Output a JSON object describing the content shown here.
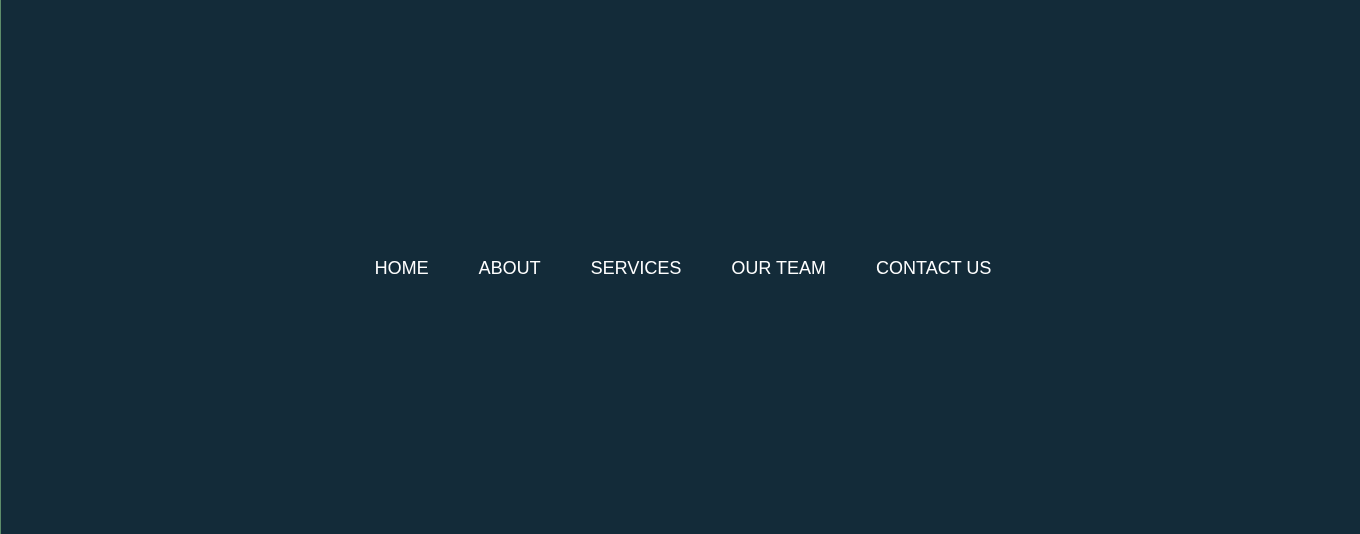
{
  "theme": {
    "background": "#132b39",
    "text": "#ffffff",
    "edge_accent": "#5d8c6a"
  },
  "nav": {
    "items": [
      {
        "label": "HOME"
      },
      {
        "label": "ABOUT"
      },
      {
        "label": "SERVICES"
      },
      {
        "label": "OUR TEAM"
      },
      {
        "label": "CONTACT US"
      }
    ]
  }
}
